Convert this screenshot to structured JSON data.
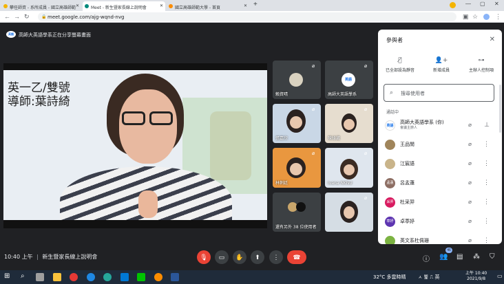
{
  "browser": {
    "tabs": [
      {
        "label": "攀任師資 - 系所成員 - 國立高雄師範",
        "active": false
      },
      {
        "label": "Meet - 新生暨家長線上說明會",
        "active": true
      },
      {
        "label": "國立高雄師範大學 - 首頁",
        "active": false
      }
    ],
    "new_tab": "+",
    "url": "meet.google.com/ajg-wqnd-nvg"
  },
  "meeting": {
    "share_banner": "高師大英語學系正在分享螢幕畫面",
    "presenter_logo": "英語",
    "main_video_text_line1": "英一乙/雙號",
    "main_video_text_line2": "導師:葉詩綺",
    "tiles": [
      {
        "name": "賴資晴"
      },
      {
        "name": "高師大英語學系"
      },
      {
        "name": "張嘉欣"
      },
      {
        "name": "陳綠葳"
      },
      {
        "name": "林俐廷"
      },
      {
        "name": "Ivana NKNU"
      },
      {
        "name": "還有另外 38 位使用者"
      },
      {
        "name": ""
      }
    ]
  },
  "panel": {
    "title": "參與者",
    "actions": [
      {
        "label": "已全部設為靜音",
        "icon": "mic-off-icon"
      },
      {
        "label": "新增成員",
        "icon": "add-person-icon"
      },
      {
        "label": "主辦人控制項",
        "icon": "toggle-icon"
      }
    ],
    "search_placeholder": "搜尋使用者",
    "section": "通話中",
    "participants": [
      {
        "name": "高師大英語學系 (你)",
        "sub": "會議主辦人",
        "avatar_text": "英語",
        "avatar_color": "#ffffff"
      },
      {
        "name": "王品閒",
        "sub": "",
        "avatar_text": "",
        "avatar_color": "#a0855b"
      },
      {
        "name": "江宸語",
        "sub": "",
        "avatar_text": "",
        "avatar_color": "#c9b48a"
      },
      {
        "name": "呂孟蓮",
        "sub": "",
        "avatar_text": "孟蓮",
        "avatar_color": "#8d6e63"
      },
      {
        "name": "杜采羿",
        "sub": "",
        "avatar_text": "采羿",
        "avatar_color": "#d81b60"
      },
      {
        "name": "卓葶妤",
        "sub": "",
        "avatar_text": "葶妤",
        "avatar_color": "#5e35b1"
      },
      {
        "name": "英文系杜佩珊",
        "sub": "",
        "avatar_text": "",
        "avatar_color": "#7cb342"
      }
    ]
  },
  "controls": {
    "time": "10:40 上午",
    "separator": "|",
    "meeting_name": "新生暨家長線上說明會",
    "participant_count": "46"
  },
  "taskbar": {
    "weather": "32°C 多雲時晴",
    "tray": "ㅅ 쀭 ⎍ 英",
    "time": "上午 10:40",
    "date": "2021/9/8"
  },
  "colors": {
    "meet_bg": "#202124",
    "hangup_red": "#ea4335",
    "accent_blue": "#8ab4f8"
  }
}
